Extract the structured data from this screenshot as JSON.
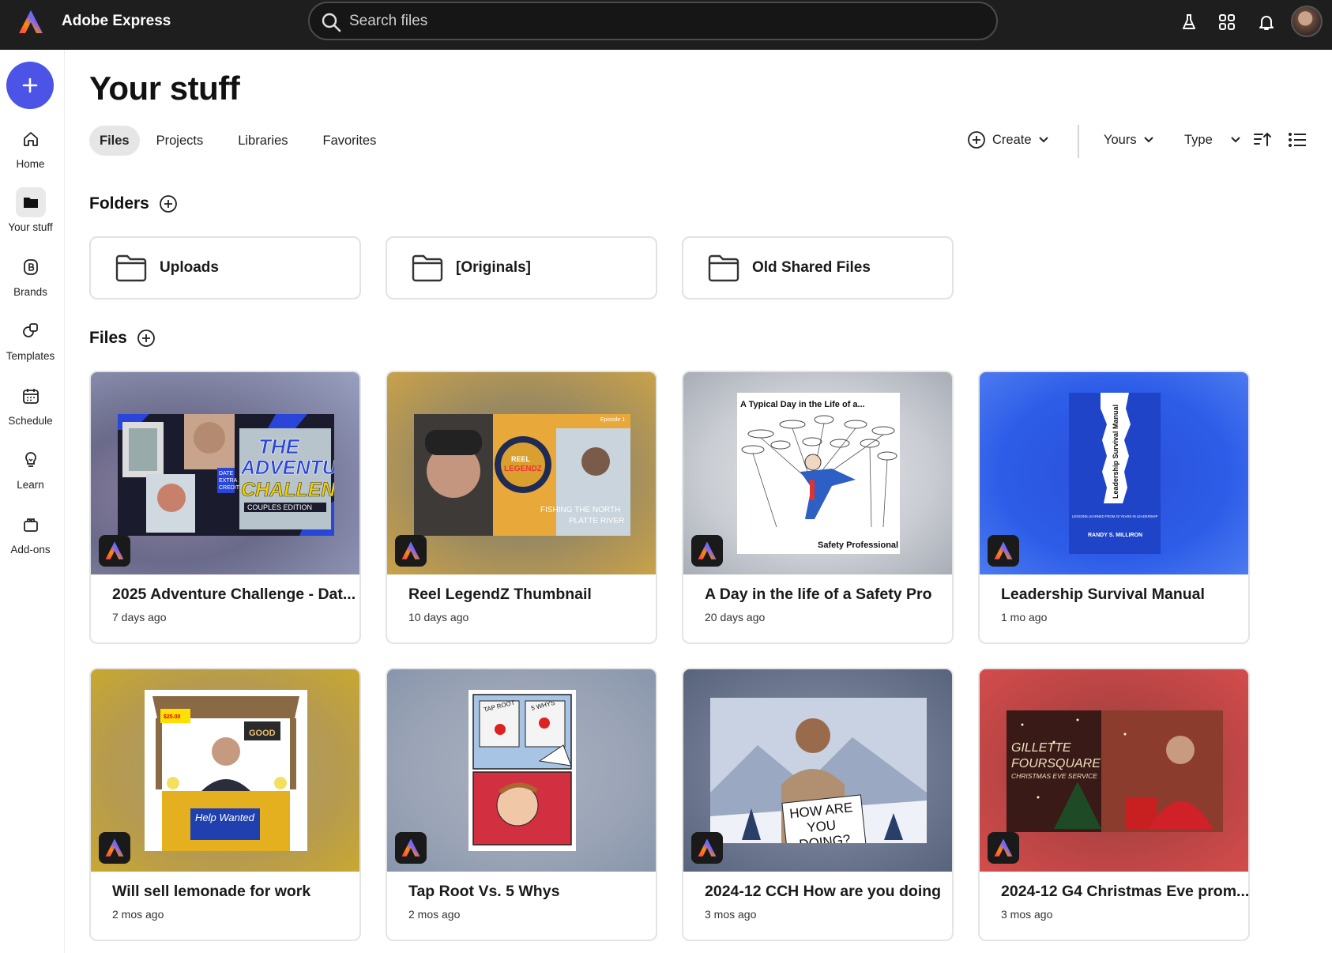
{
  "app": {
    "title": "Adobe Express"
  },
  "search": {
    "placeholder": "Search files"
  },
  "rail": {
    "create_label": "+",
    "items": [
      {
        "label": "Home",
        "icon": "home-icon"
      },
      {
        "label": "Your stuff",
        "icon": "folder-icon"
      },
      {
        "label": "Brands",
        "icon": "brand-icon"
      },
      {
        "label": "Templates",
        "icon": "templates-icon"
      },
      {
        "label": "Schedule",
        "icon": "calendar-icon"
      },
      {
        "label": "Learn",
        "icon": "lightbulb-icon"
      },
      {
        "label": "Add-ons",
        "icon": "addons-icon"
      }
    ]
  },
  "page": {
    "title": "Your stuff"
  },
  "tabs": [
    {
      "label": "Files",
      "active": true
    },
    {
      "label": "Projects"
    },
    {
      "label": "Libraries"
    },
    {
      "label": "Favorites"
    }
  ],
  "toolbar": {
    "create": "Create",
    "owner_filter": "Yours",
    "type_filter": "Type"
  },
  "folders": {
    "heading": "Folders",
    "items": [
      {
        "name": "Uploads"
      },
      {
        "name": "[Originals]"
      },
      {
        "name": "Old Shared Files"
      }
    ]
  },
  "files": {
    "heading": "Files",
    "items": [
      {
        "name": "2025 Adventure Challenge - Dat...",
        "date": "7 days ago",
        "thumb_text": [
          "THE",
          "ADVENTURE",
          "CHALLENGE",
          "COUPLES EDITION",
          "DATE",
          "EXTRA",
          "CREDIT"
        ]
      },
      {
        "name": "Reel LegendZ Thumbnail",
        "date": "10 days ago",
        "thumb_text": [
          "Episode 1",
          "REEL",
          "LEGENDZ",
          "FISHING THE NORTH",
          "PLATTE RIVER"
        ]
      },
      {
        "name": "A Day in the life of a Safety Pro",
        "date": "20 days ago",
        "thumb_text": [
          "A Typical Day in the Life of a...",
          "Safety Professional"
        ]
      },
      {
        "name": "Leadership Survival Manual",
        "date": "1 mo ago",
        "thumb_text": [
          "Leadership Survival Manual",
          "LESSONS LEARNED FROM 20 YEARS IN LEADERSHIP",
          "RANDY S. MILLIRON"
        ]
      },
      {
        "name": "Will sell lemonade for work",
        "date": "2 mos ago",
        "thumb_text": [
          "$25.00",
          "GOOD",
          "Help Wanted"
        ]
      },
      {
        "name": "Tap Root Vs. 5 Whys",
        "date": "2 mos ago",
        "thumb_text": [
          "TAP ROOT",
          "5 WHYS"
        ]
      },
      {
        "name": "2024-12 CCH How are you doing",
        "date": "3 mos ago",
        "thumb_text": [
          "HOW ARE",
          "YOU",
          "DOING?"
        ]
      },
      {
        "name": "2024-12 G4 Christmas Eve prom...",
        "date": "3 mos ago",
        "thumb_text": [
          "GILLETTE",
          "FOURSQUARE",
          "CHRISTMAS EVE SERVICE"
        ]
      }
    ]
  },
  "colors": {
    "topbar": "#1e1e1e",
    "accent": "#4b54e6"
  }
}
